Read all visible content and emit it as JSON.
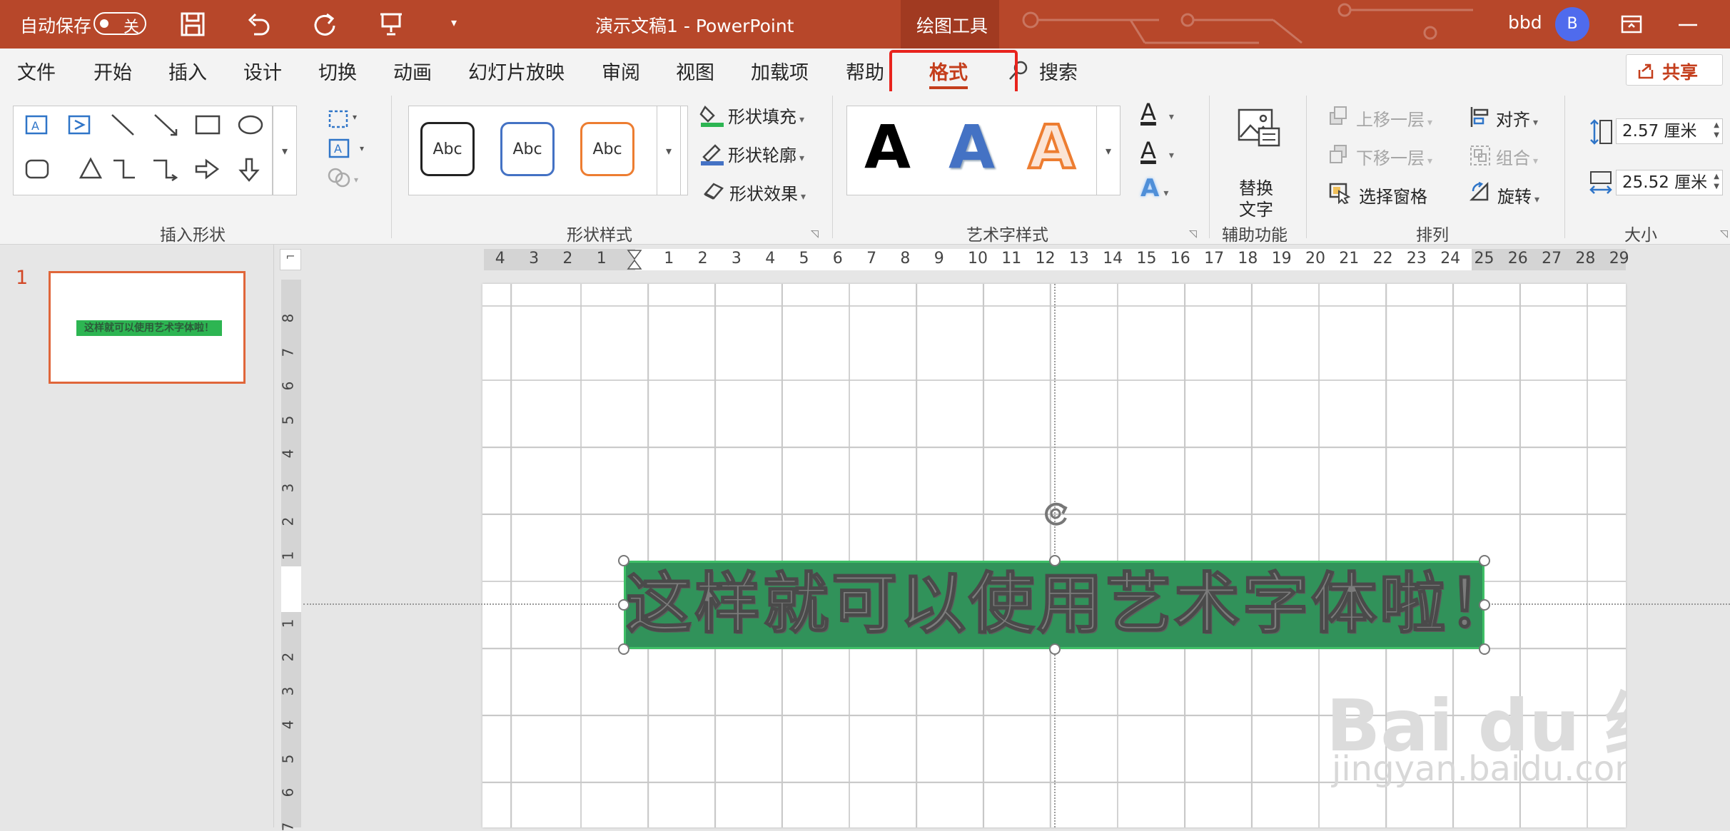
{
  "titlebar": {
    "autosave_label": "自动保存",
    "autosave_state": "关",
    "doc_title": "演示文稿1  -  PowerPoint",
    "context_tab": "绘图工具",
    "user_name": "bbd",
    "avatar_initial": "B"
  },
  "menu": {
    "items": [
      "文件",
      "开始",
      "插入",
      "设计",
      "切换",
      "动画",
      "幻灯片放映",
      "审阅",
      "视图",
      "加载项",
      "帮助",
      "格式"
    ],
    "search_label": "搜索",
    "share_label": "共享",
    "active": "格式"
  },
  "ribbon": {
    "groups": {
      "insert_shapes": "插入形状",
      "shape_styles": "形状样式",
      "wordart_styles": "艺术字样式",
      "accessibility": "辅助功能",
      "arrange": "排列",
      "size": "大小"
    },
    "shape_style_samples": [
      "Abc",
      "Abc",
      "Abc"
    ],
    "shape_fill": "形状填充",
    "shape_outline": "形状轮廓",
    "shape_effects": "形状效果",
    "wordart_samples": [
      "A",
      "A",
      "A"
    ],
    "text_fill_glyph": "A",
    "text_outline_glyph": "A",
    "text_effect_glyph": "A",
    "alt_text_line1": "替换",
    "alt_text_line2": "文字",
    "bring_forward": "上移一层",
    "send_backward": "下移一层",
    "selection_pane": "选择窗格",
    "align": "对齐",
    "group": "组合",
    "rotate": "旋转",
    "height_value": "2.57 厘米",
    "width_value": "25.52 厘米"
  },
  "slides_pane": {
    "slide_number": "1",
    "thumb_text": "这样就可以使用艺术字体啦！"
  },
  "ruler": {
    "h_numbers": [
      "4",
      "3",
      "2",
      "1",
      "1",
      "2",
      "3",
      "4",
      "5",
      "6",
      "7",
      "8",
      "9",
      "10",
      "11",
      "12",
      "13",
      "14",
      "15",
      "16",
      "17",
      "18",
      "19",
      "20",
      "21",
      "22",
      "23",
      "24",
      "25",
      "26",
      "27",
      "28",
      "29"
    ],
    "v_numbers": [
      "8",
      "7",
      "6",
      "5",
      "4",
      "3",
      "2",
      "1",
      "1",
      "2",
      "3",
      "4",
      "5",
      "6",
      "7"
    ]
  },
  "slide": {
    "wordart_text": "这样就可以使用艺术字体啦！"
  },
  "watermark": {
    "logo": "Bai du 经验",
    "url": "jingyan.baidu.com"
  },
  "colors": {
    "titlebar": "#b7472a",
    "accent": "#c43e1c",
    "wordart_fill": "#31925a",
    "highlight_box": "#e8231d"
  }
}
